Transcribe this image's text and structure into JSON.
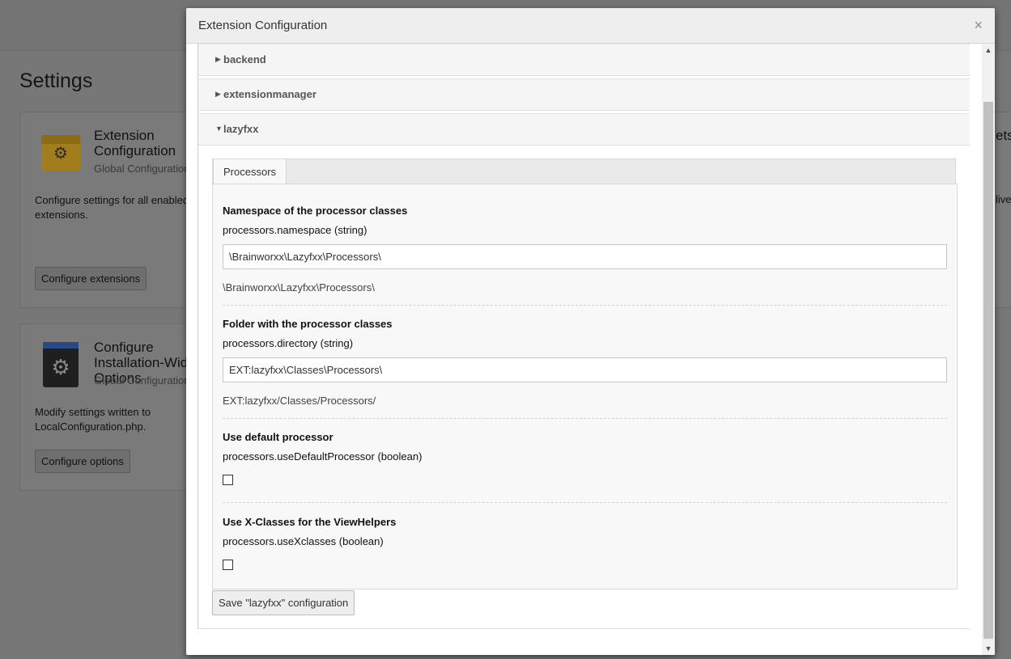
{
  "background": {
    "page_title": "Settings",
    "card1": {
      "title": "Extension Configuration",
      "subtitle": "Global Configuration",
      "description": "Configure settings for all enabled extensions.",
      "button_label": "Configure extensions"
    },
    "card2": {
      "title": "Configure Installation-Wide Options",
      "subtitle": "Global Configuration",
      "description": "Modify settings written to LocalConfiguration.php.",
      "button_label": "Configure options"
    },
    "right_edge_title": "ets",
    "right_edge_text": "live"
  },
  "modal": {
    "title": "Extension Configuration",
    "close_label": "×",
    "panels": [
      {
        "title": "backend"
      },
      {
        "title": "extensionmanager"
      },
      {
        "title": "lazyfxx"
      }
    ],
    "tab_label": "Processors",
    "fields": [
      {
        "label": "Namespace of the processor classes",
        "key": "processors.namespace (string)",
        "value": "\\Brainworxx\\Lazyfxx\\Processors\\",
        "default": "\\Brainworxx\\Lazyfxx\\Processors\\"
      },
      {
        "label": "Folder with the processor classes",
        "key": "processors.directory (string)",
        "value": "EXT:lazyfxx\\Classes\\Processors\\",
        "default": "EXT:lazyfxx/Classes/Processors/"
      },
      {
        "label": "Use default processor",
        "key": "processors.useDefaultProcessor (boolean)"
      },
      {
        "label": "Use X-Classes for the ViewHelpers",
        "key": "processors.useXclasses (boolean)"
      }
    ],
    "save_button_label": "Save \"lazyfxx\" configuration"
  }
}
